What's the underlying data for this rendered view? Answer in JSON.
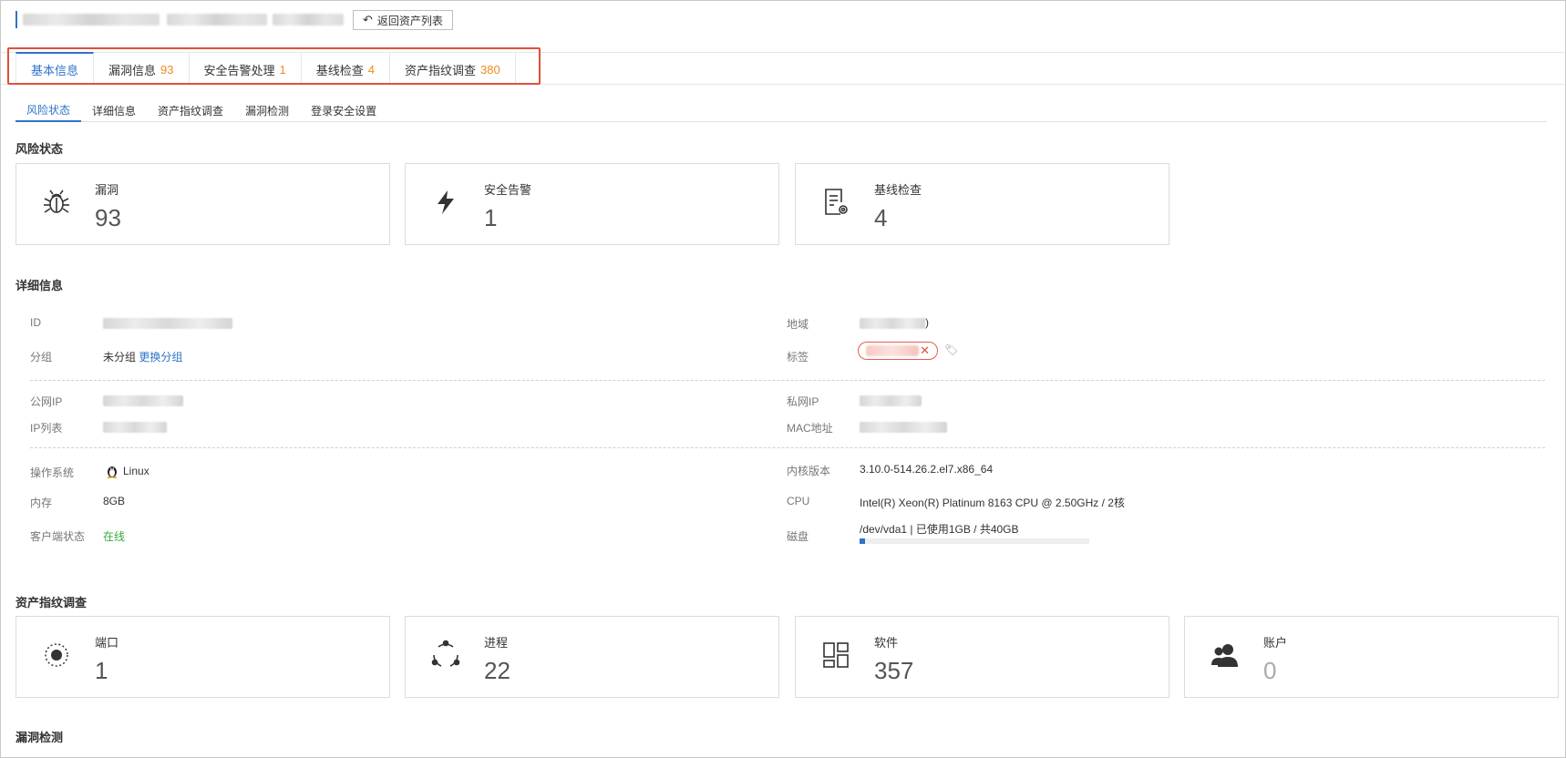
{
  "header": {
    "back_label": "返回资产列表"
  },
  "tabs": [
    {
      "label": "基本信息",
      "count": ""
    },
    {
      "label": "漏洞信息",
      "count": "93"
    },
    {
      "label": "安全告警处理",
      "count": "1"
    },
    {
      "label": "基线检查",
      "count": "4"
    },
    {
      "label": "资产指纹调查",
      "count": "380"
    }
  ],
  "subtabs": [
    "风险状态",
    "详细信息",
    "资产指纹调查",
    "漏洞检测",
    "登录安全设置"
  ],
  "risk": {
    "title": "风险状态",
    "cards": [
      {
        "label": "漏洞",
        "value": "93",
        "icon": "bug-icon"
      },
      {
        "label": "安全告警",
        "value": "1",
        "icon": "lightning-icon"
      },
      {
        "label": "基线检查",
        "value": "4",
        "icon": "checklist-icon"
      }
    ]
  },
  "detail": {
    "title": "详细信息",
    "id_label": "ID",
    "region_label": "地域",
    "region_suffix": ")",
    "group_label": "分组",
    "group_value": "未分组",
    "group_link": "更换分组",
    "tag_label": "标签",
    "public_ip_label": "公网IP",
    "private_ip_label": "私网IP",
    "ip_list_label": "IP列表",
    "mac_label": "MAC地址",
    "os_label": "操作系统",
    "os_value": "Linux",
    "kernel_label": "内核版本",
    "kernel_value": "3.10.0-514.26.2.el7.x86_64",
    "memory_label": "内存",
    "memory_value": "8GB",
    "cpu_label": "CPU",
    "cpu_value": "Intel(R) Xeon(R) Platinum 8163 CPU @ 2.50GHz / 2核",
    "client_label": "客户端状态",
    "client_value": "在线",
    "disk_label": "磁盘",
    "disk_value": "/dev/vda1 | 已使用1GB / 共40GB",
    "disk_used_fraction": 0.025
  },
  "fingerprint": {
    "title": "资产指纹调查",
    "cards": [
      {
        "label": "端口",
        "value": "1",
        "icon": "port-icon"
      },
      {
        "label": "进程",
        "value": "22",
        "icon": "process-icon"
      },
      {
        "label": "软件",
        "value": "357",
        "icon": "software-grid-icon"
      },
      {
        "label": "账户",
        "value": "0",
        "icon": "users-icon"
      }
    ]
  },
  "vuln_detect": {
    "title": "漏洞检测"
  },
  "colors": {
    "accent": "#2f73c9",
    "count_orange": "#f08c1e",
    "highlight_red": "#e0503a",
    "online_green": "#3aa83a"
  }
}
